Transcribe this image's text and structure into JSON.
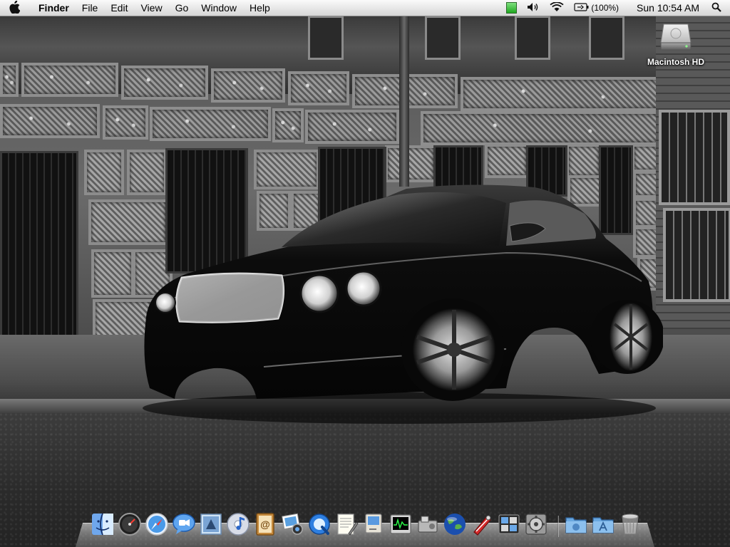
{
  "menubar": {
    "app_name": "Finder",
    "menus": [
      "File",
      "Edit",
      "View",
      "Go",
      "Window",
      "Help"
    ],
    "status": {
      "battery_percent": "(100%)",
      "clock": "Sun 10:54 AM"
    },
    "icons": [
      "apple-icon",
      "activity-meter-icon",
      "volume-icon",
      "wifi-icon",
      "battery-icon",
      "spotlight-icon"
    ]
  },
  "desktop": {
    "icons": [
      {
        "label": "Macintosh HD",
        "icon": "hard-drive-icon"
      }
    ],
    "wallpaper": "black-luxury-coupe-grayscale-street"
  },
  "dock": {
    "items": [
      {
        "name": "finder-icon"
      },
      {
        "name": "dashboard-icon"
      },
      {
        "name": "safari-icon"
      },
      {
        "name": "ichat-icon"
      },
      {
        "name": "mail-icon"
      },
      {
        "name": "itunes-icon"
      },
      {
        "name": "address-book-icon"
      },
      {
        "name": "iphoto-icon"
      },
      {
        "name": "quicktime-icon"
      },
      {
        "name": "textedit-icon"
      },
      {
        "name": "classic-mac-icon"
      },
      {
        "name": "activity-monitor-icon"
      },
      {
        "name": "system-profiler-icon"
      },
      {
        "name": "google-earth-icon"
      },
      {
        "name": "utility-app-icon"
      },
      {
        "name": "spaces-icon"
      },
      {
        "name": "system-preferences-icon"
      },
      {
        "name": "downloads-folder-icon"
      },
      {
        "name": "applications-folder-icon"
      },
      {
        "name": "trash-icon"
      }
    ]
  }
}
